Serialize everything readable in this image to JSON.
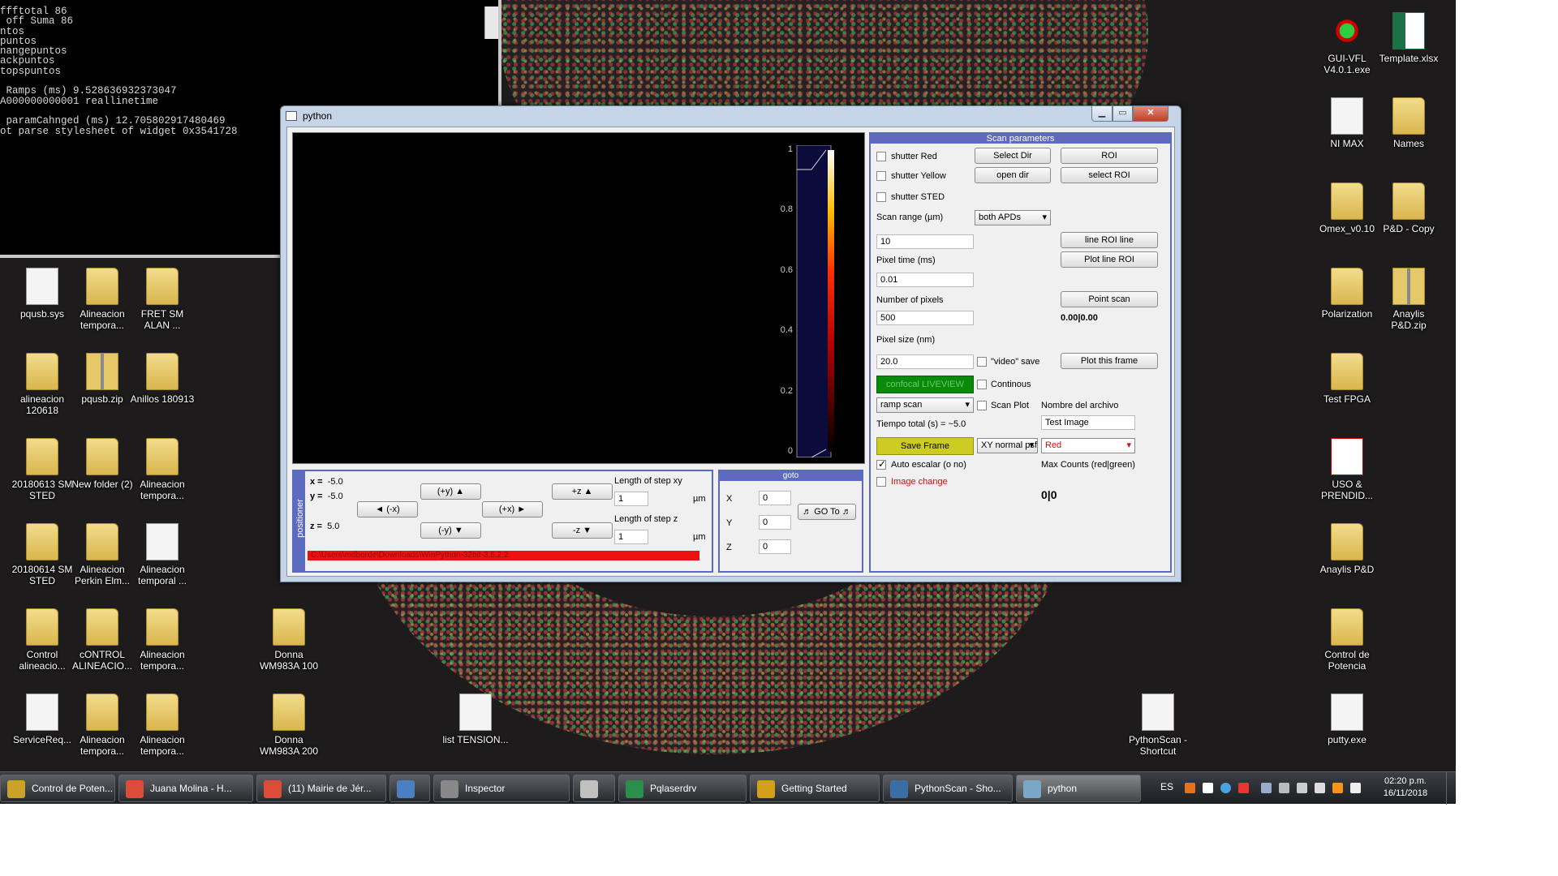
{
  "console": {
    "lines": [
      "ffftotal 86",
      " off Suma 86",
      "ntos",
      "puntos",
      "nangepuntos",
      "ackpuntos",
      "topspuntos",
      "",
      " Ramps (ms) 9.528636932373047",
      "A000000000001 reallinetime",
      "",
      " paramCahnged (ms) 12.705802917480469",
      "ot parse stylesheet of widget 0x3541728"
    ]
  },
  "desktop_icons_left": [
    {
      "label": "pqusb.sys",
      "kind": "file"
    },
    {
      "label": "Alineacion tempora...",
      "kind": "folder"
    },
    {
      "label": "FRET SM ALAN ...",
      "kind": "folder"
    },
    {
      "label": "alineacion 120618",
      "kind": "folder"
    },
    {
      "label": "pqusb.zip",
      "kind": "zip"
    },
    {
      "label": "Anillos 180913",
      "kind": "folder"
    },
    {
      "label": "20180613 SM STED",
      "kind": "folder"
    },
    {
      "label": "New folder (2)",
      "kind": "folder"
    },
    {
      "label": "Alineacion tempora...",
      "kind": "folder"
    },
    {
      "label": "20180614 SM STED",
      "kind": "folder"
    },
    {
      "label": "Alineacion Perkin Elm...",
      "kind": "folder"
    },
    {
      "label": "Alineacion temporal ...",
      "kind": "file"
    },
    {
      "label": "Control alineacio...",
      "kind": "folder"
    },
    {
      "label": "cONTROL ALINEACIO...",
      "kind": "folder"
    },
    {
      "label": "Alineacion tempora...",
      "kind": "folder"
    },
    {
      "label": "Donna WM983A 100",
      "kind": "folder"
    },
    {
      "label": "ServiceReq...",
      "kind": "file"
    },
    {
      "label": "Alineacion tempora...",
      "kind": "folder"
    },
    {
      "label": "Alineacion tempora...",
      "kind": "folder"
    },
    {
      "label": "Donna WM983A 200",
      "kind": "folder"
    },
    {
      "label": "list TENSION...",
      "kind": "file"
    },
    {
      "label": "PythonScan - Shortcut",
      "kind": "file"
    }
  ],
  "desktop_icons_right": [
    {
      "label": "GUI-VFL V4.0.1.exe",
      "kind": "exe"
    },
    {
      "label": "Template.xlsx",
      "kind": "xl"
    },
    {
      "label": "NI MAX",
      "kind": "file"
    },
    {
      "label": "Names",
      "kind": "folder"
    },
    {
      "label": "Omex_v0.10",
      "kind": "folder"
    },
    {
      "label": "P&D - Copy",
      "kind": "folder"
    },
    {
      "label": "Polarization",
      "kind": "folder"
    },
    {
      "label": "Anaylis P&D.zip",
      "kind": "zip"
    },
    {
      "label": "Test FPGA",
      "kind": "folder"
    },
    {
      "label": "USO & PRENDID...",
      "kind": "pdf"
    },
    {
      "label": "Anaylis P&D",
      "kind": "folder"
    },
    {
      "label": "Control de Potencia",
      "kind": "folder"
    },
    {
      "label": "putty.exe",
      "kind": "file"
    }
  ],
  "window": {
    "title": "python",
    "min_glyph": "▁",
    "max_glyph": "▭",
    "close_glyph": "✕"
  },
  "colorbar": {
    "ticks": [
      "1",
      "0.8",
      "0.6",
      "0.4",
      "0.2",
      "0"
    ],
    "tick_values": [
      1,
      0.8,
      0.6,
      0.4,
      0.2,
      0
    ]
  },
  "positioner": {
    "tab_label": "positioner",
    "x_label": "x =",
    "x_value": "-5.0",
    "y_label": "y =",
    "y_value": "-5.0",
    "z_label": "z =",
    "z_value": "5.0",
    "btn_plus_y": "(+y) ▲",
    "btn_minus_x": "◄ (-x)",
    "btn_plus_x": "(+x) ►",
    "btn_minus_y": "(-y) ▼",
    "btn_plus_z": "+z ▲",
    "btn_minus_z": "-z ▼",
    "step_xy_label": "Length of step xy",
    "step_xy_value": "1",
    "step_z_label": "Length of step z",
    "step_z_value": "1",
    "unit": "µm",
    "path": "C:\\Users\\mdborde\\Downloads\\WinPython-32bit-3.5.2.2"
  },
  "goto": {
    "header": "goto",
    "x_label": "X",
    "x_value": "0",
    "y_label": "Y",
    "y_value": "0",
    "z_label": "Z",
    "z_value": "0",
    "button": "♬ GO To ♬"
  },
  "scan": {
    "header": "Scan parameters",
    "shutter_red": "shutter Red",
    "shutter_yellow": "shutter Yellow",
    "shutter_sted": "shutter STED",
    "select_dir": "Select Dir",
    "roi": "ROI",
    "open_dir": "open dir",
    "select_roi": "select ROI",
    "scan_range_label": "Scan range (µm)",
    "apd_combo": "both APDs",
    "scan_range_value": "10",
    "line_roi_line": "line ROI line",
    "pixel_time_label": "Pixel time (ms)",
    "plot_line_roi": "Plot line ROI",
    "pixel_time_value": "0.01",
    "num_pixels_label": "Number of pixels",
    "point_scan": "Point scan",
    "num_pixels_value": "500",
    "point_value": "0.00|0.00",
    "pixel_size_label": "Pixel size (nm)",
    "pixel_size_value": "20.0",
    "video_save": "\"video\" save",
    "plot_this_frame": "Plot this frame",
    "liveview": "confocal LIVEVIEW",
    "continous": "Continous",
    "ramp_combo": "ramp scan",
    "scan_plot": "Scan Plot",
    "filename_label": "Nombre del archivo",
    "total_time": "Tiempo total (s) = ~5.0",
    "filename_value": "Test Image",
    "save_frame": "Save Frame",
    "psf_combo": "XY normal psf",
    "color_combo": "Red",
    "auto_scale": "Auto escalar (o no)",
    "max_counts_label": "Max Counts (red|green)",
    "image_change": "Image change",
    "max_counts_value": "0|0",
    "accent": "#5c6bc0"
  },
  "taskbar": {
    "items": [
      {
        "label": "Control de Poten...",
        "color": "#c9a227"
      },
      {
        "label": "Juana Molina - H...",
        "color": "#dd4b39"
      },
      {
        "label": "(11) Mairie de Jér...",
        "color": "#dd4b39"
      },
      {
        "label": "",
        "color": "#4a7fc1"
      },
      {
        "label": "Inspector",
        "color": "#888888"
      },
      {
        "label": "",
        "color": "#c0c0c0"
      },
      {
        "label": "Pqlaserdrv",
        "color": "#2a8f4a"
      },
      {
        "label": "Getting Started",
        "color": "#d4a017"
      },
      {
        "label": "PythonScan - Sho...",
        "color": "#3a6ea5"
      },
      {
        "label": "python",
        "color": "#7aa7c7"
      }
    ],
    "lang": "ES",
    "time": "02:20 p.m.",
    "date": "16/11/2018"
  }
}
